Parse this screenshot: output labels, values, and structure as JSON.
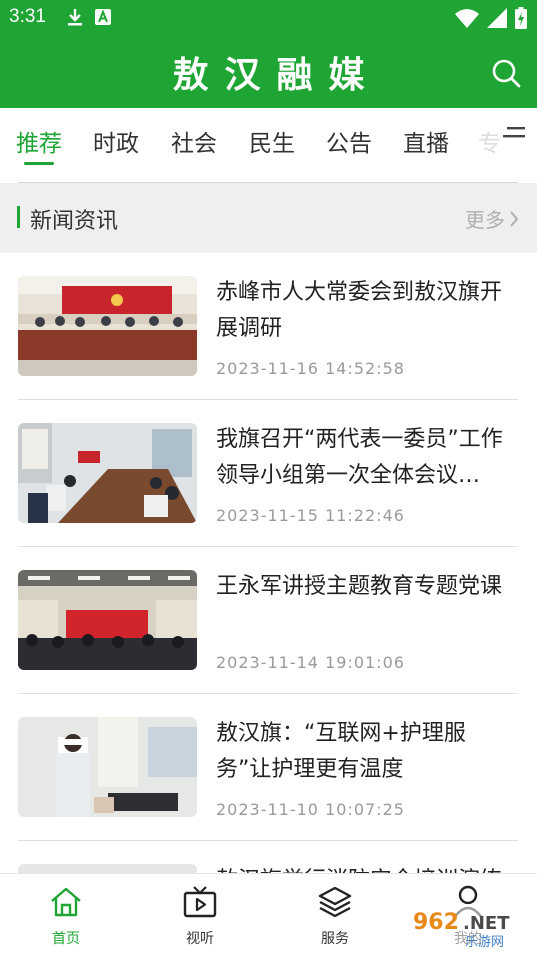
{
  "status_bar": {
    "time": "3:31",
    "left_icons": [
      "download-icon",
      "a-badge-icon"
    ],
    "right_icons": [
      "wifi-icon",
      "signal-icon",
      "battery-icon"
    ]
  },
  "header": {
    "title": "敖汉融媒",
    "background": "#1fa533",
    "search_icon": "search-icon"
  },
  "tabs": {
    "items": [
      "推荐",
      "时政",
      "社会",
      "民生",
      "公告",
      "直播",
      "专"
    ],
    "active": "推荐",
    "menu_icon": "menu-icon"
  },
  "section": {
    "title": "新闻资讯",
    "more": "更多"
  },
  "news": [
    {
      "title": "赤峰市人大常委会到敖汉旗开展调研",
      "time": "2023-11-16  14:52:58"
    },
    {
      "title": "我旗召开“两代表一委员”工作领导小组第一次全体会议…",
      "time": "2023-11-15  11:22:46"
    },
    {
      "title": "王永军讲授主题教育专题党课",
      "time": "2023-11-14  19:01:06"
    },
    {
      "title": "敖汉旗：“互联网+护理服务”让护理更有温度",
      "time": "2023-11-10  10:07:25"
    },
    {
      "title": "敖汉旗举行消防安全培训演练",
      "time": ""
    }
  ],
  "bottom_nav": {
    "items": [
      {
        "label": "首页",
        "icon": "home-icon"
      },
      {
        "label": "视听",
        "icon": "tv-play-icon"
      },
      {
        "label": "服务",
        "icon": "layers-icon"
      },
      {
        "label": "我的",
        "icon": "user-icon"
      }
    ],
    "active": "首页"
  },
  "watermark": {
    "brand": "962.NET",
    "caption": "乐游网"
  },
  "colors": {
    "accent": "#1fa533",
    "muted": "#9a9a9a"
  }
}
